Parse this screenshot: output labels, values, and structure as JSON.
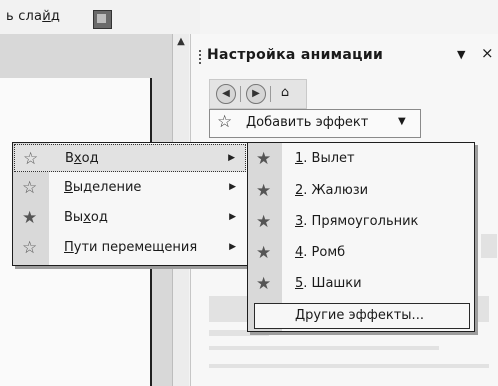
{
  "slide": {
    "caption_prefix": "ь сла",
    "caption_underlined": "й",
    "caption_suffix": "д"
  },
  "task_pane": {
    "title": "Настройка анимации",
    "menu_glyph": "▼",
    "close_glyph": "×",
    "nav_buttons": [
      "◀",
      "▶"
    ],
    "home_glyph": "⌂",
    "add_effect_label": "Добавить эффект",
    "add_effect_arrow": "▼"
  },
  "effect_menu": {
    "items": [
      {
        "icon": "☆",
        "pre": "В",
        "accel": "х",
        "post": "од",
        "submenu": "▶"
      },
      {
        "icon": "☆",
        "pre": "",
        "accel": "В",
        "post": "ыделение",
        "submenu": "▶"
      },
      {
        "icon": "★",
        "pre": "Вы",
        "accel": "х",
        "post": "од",
        "submenu": "▶"
      },
      {
        "icon": "☆",
        "pre": "",
        "accel": "П",
        "post": "ути перемещения",
        "submenu": "▶"
      }
    ]
  },
  "entrance_submenu": {
    "items": [
      {
        "icon": "★",
        "num": "1",
        "label": ". Вылет"
      },
      {
        "icon": "★",
        "num": "2",
        "label": ". Жалюзи"
      },
      {
        "icon": "★",
        "num": "3",
        "label": ". Прямоугольник"
      },
      {
        "icon": "★",
        "num": "4",
        "label": ". Ромб"
      },
      {
        "icon": "★",
        "num": "5",
        "label": ". Шашки"
      }
    ],
    "more_pre": "",
    "more_accel": "Д",
    "more_post": "ругие эффекты..."
  },
  "colors": {
    "menu_border": "#1e1e1e",
    "icon_column": "#d9d9d9",
    "menu_bg": "#f7f7f7"
  }
}
